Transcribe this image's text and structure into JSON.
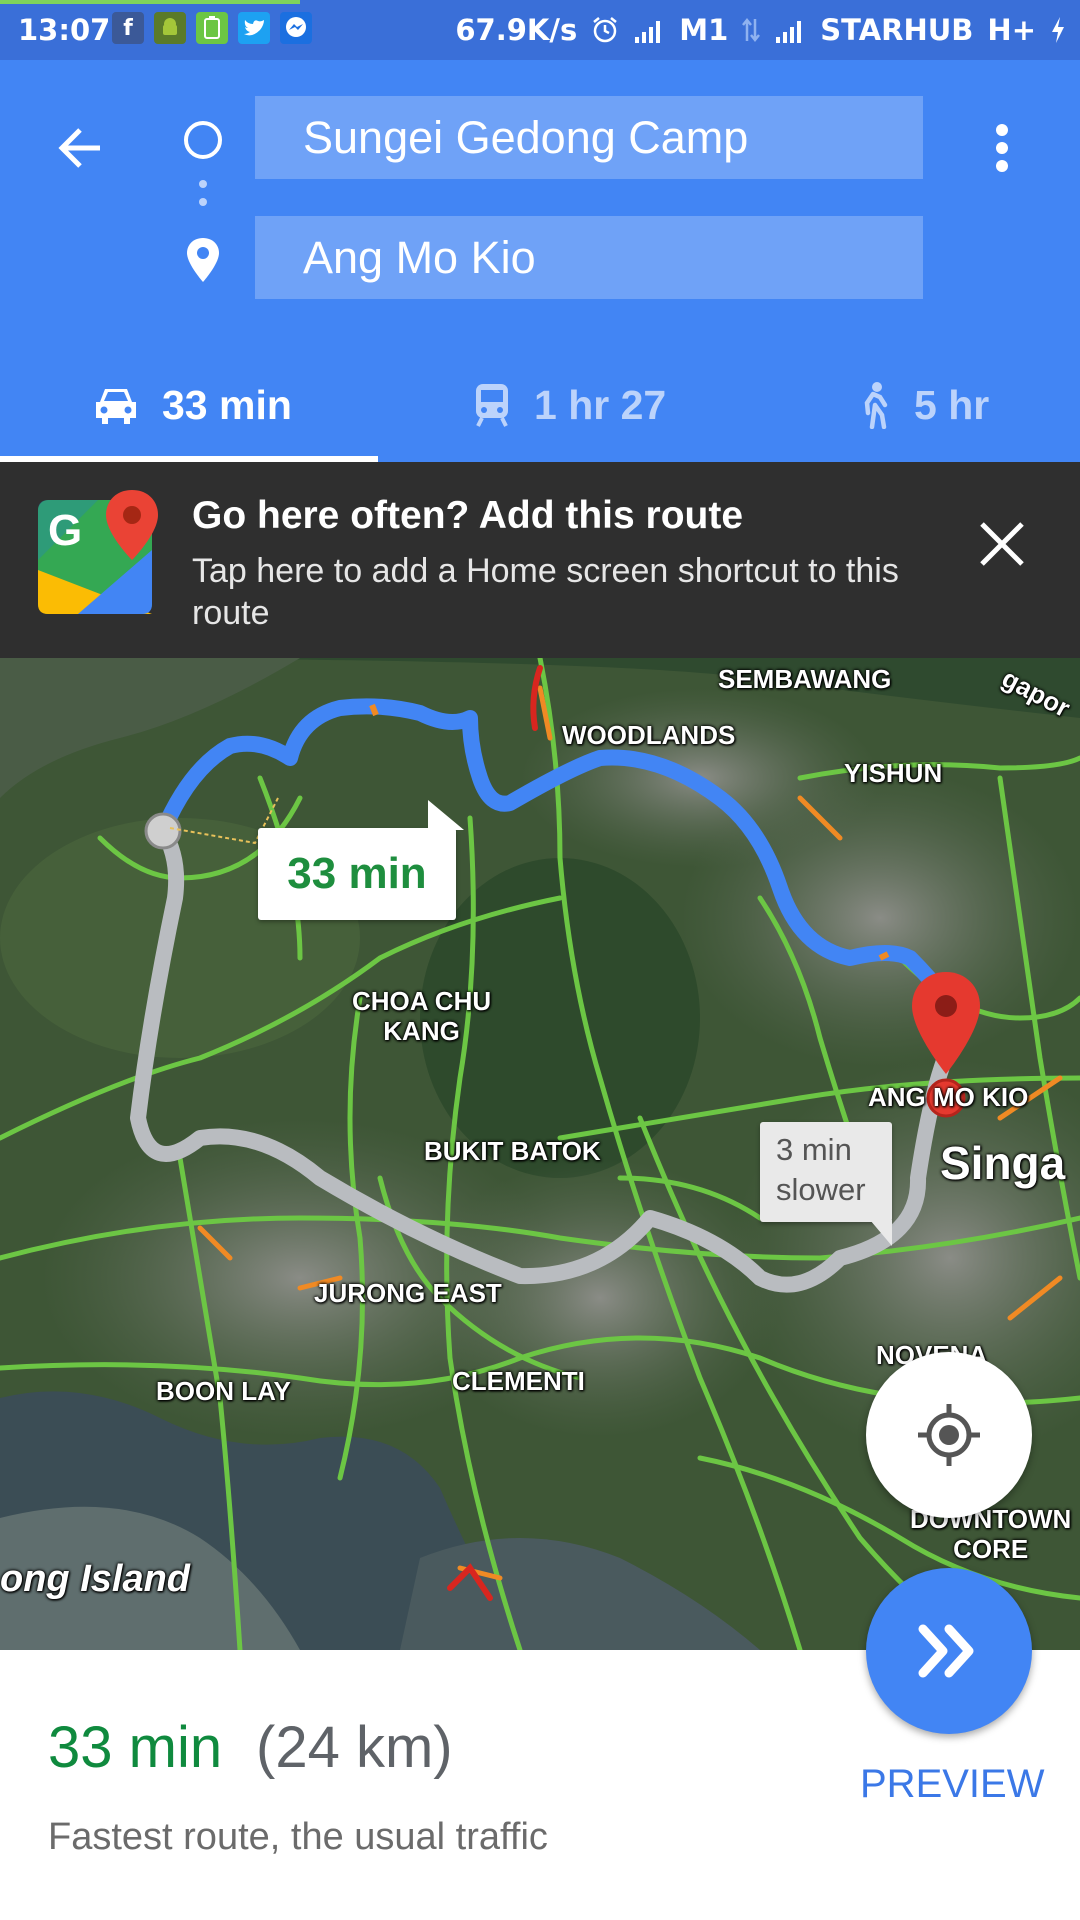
{
  "status_bar": {
    "time": "13:07",
    "network_speed": "67.9K/s",
    "carrier1": "M1",
    "carrier2": "STARHUB",
    "network_type": "H+",
    "app_icons": [
      "facebook-icon",
      "android-icon",
      "battery-app-icon",
      "twitter-icon",
      "messenger-icon"
    ]
  },
  "header": {
    "origin": "Sungei Gedong Camp",
    "destination": "Ang Mo Kio",
    "modes": [
      {
        "icon": "car-icon",
        "label": "33 min",
        "selected": true
      },
      {
        "icon": "train-icon",
        "label": "1 hr 27",
        "selected": false
      },
      {
        "icon": "walk-icon",
        "label": "5 hr",
        "selected": false
      }
    ]
  },
  "promo": {
    "title": "Go here often? Add this route",
    "subtitle": "Tap here to add a Home screen shortcut to this route"
  },
  "map": {
    "fastest_callout": "33 min",
    "alt_callout_line1": "3 min",
    "alt_callout_line2": "slower",
    "labels": {
      "sembawang": "SEMBAWANG",
      "woodlands": "WOODLANDS",
      "yishun": "YISHUN",
      "choa_chu_kang_1": "CHOA CHU",
      "choa_chu_kang_2": "KANG",
      "ang_mo_kio": "ANG MO KIO",
      "bukit_batok": "BUKIT BATOK",
      "singapore": "Singa",
      "singapore_corner": "gapor",
      "jurong_east": "JURONG EAST",
      "novena": "NOVENA",
      "boon_lay": "BOON LAY",
      "clementi": "CLEMENTI",
      "downtown_1": "DOWNTOWN",
      "downtown_2": "CORE",
      "island": "ong Island"
    },
    "colors": {
      "primary_route": "#4285f4",
      "alt_route": "#b9bcc0",
      "traffic_free": "#6cc644",
      "traffic_slow": "#f08a24",
      "traffic_jam": "#d8261f",
      "destination_pin": "#e5392f"
    }
  },
  "summary": {
    "duration": "33 min",
    "distance": "(24 km)",
    "description": "Fastest route, the usual traffic",
    "preview_label": "PREVIEW"
  }
}
